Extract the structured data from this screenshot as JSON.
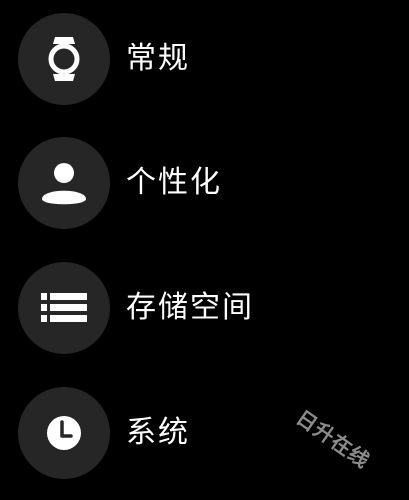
{
  "menu": {
    "items": [
      {
        "label": "常规",
        "icon": "watch-icon"
      },
      {
        "label": "个性化",
        "icon": "person-icon"
      },
      {
        "label": "存储空间",
        "icon": "storage-icon"
      },
      {
        "label": "系统",
        "icon": "clock-icon"
      }
    ]
  },
  "watermark": "日升在线",
  "colors": {
    "background": "#000000",
    "icon_circle": "#262626",
    "text": "#ffffff"
  }
}
